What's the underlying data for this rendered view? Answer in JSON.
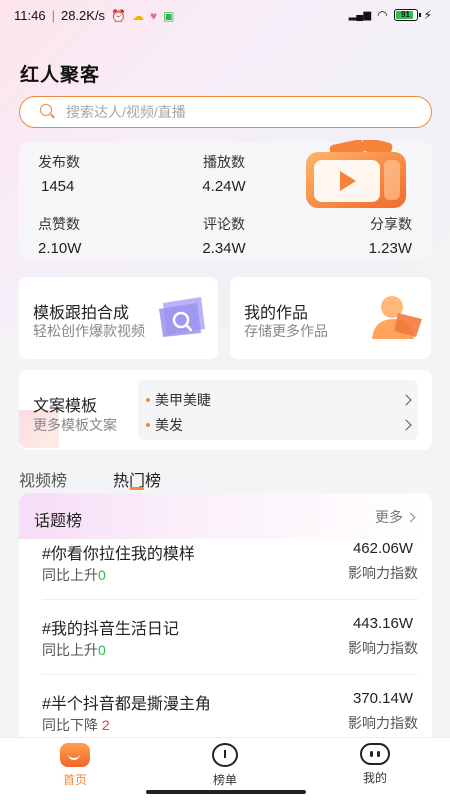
{
  "status_bar": {
    "time": "11:46",
    "speed": "28.2K/s",
    "battery": "91",
    "battery_level": 0.91
  },
  "app": {
    "title": "红人聚客"
  },
  "search": {
    "placeholder": "搜索达人/视频/直播"
  },
  "stats": {
    "publish": {
      "label": "发布数",
      "value": "1454"
    },
    "plays": {
      "label": "播放数",
      "value": "4.24W"
    },
    "likes": {
      "label": "点赞数",
      "value": "2.10W"
    },
    "comments": {
      "label": "评论数",
      "value": "2.34W"
    },
    "shares": {
      "label": "分享数",
      "value": "1.23W"
    }
  },
  "cards": {
    "template": {
      "title": "模板跟拍合成",
      "subtitle": "轻松创作爆款视频"
    },
    "works": {
      "title": "我的作品",
      "subtitle": "存储更多作品"
    }
  },
  "copy_template": {
    "title": "文案模板",
    "subtitle": "更多模板文案",
    "items": [
      {
        "label": "美甲美睫"
      },
      {
        "label": "美发"
      }
    ]
  },
  "tabs": [
    {
      "label": "视频榜",
      "active": false
    },
    {
      "label": "热门榜",
      "active": true
    }
  ],
  "topics": {
    "title": "话题榜",
    "more": "更多",
    "score_label": "影响力指数",
    "rows": [
      {
        "name": "#你看你拉住我的模样",
        "trend_text": "同比上升",
        "trend_value": "0",
        "direction": "up",
        "score": "462.06W"
      },
      {
        "name": "#我的抖音生活日记",
        "trend_text": "同比上升",
        "trend_value": "0",
        "direction": "up",
        "score": "443.16W"
      },
      {
        "name": "#半个抖音都是撕漫主角",
        "trend_text": "同比下降",
        "trend_value": "2",
        "direction": "down",
        "score": "370.14W"
      }
    ]
  },
  "bottom_nav": [
    {
      "label": "首页",
      "icon": "home-icon",
      "active": true
    },
    {
      "label": "榜单",
      "icon": "ranking-icon",
      "active": false
    },
    {
      "label": "我的",
      "icon": "profile-icon",
      "active": false
    }
  ],
  "colors": {
    "accent": "#f08a3a",
    "trend_up": "#2fb74a",
    "trend_down": "#e53935"
  }
}
